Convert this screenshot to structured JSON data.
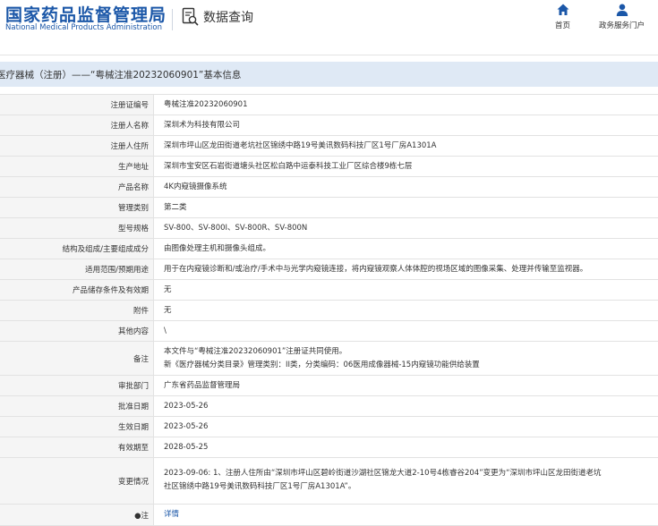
{
  "header": {
    "logo_cn": "国家药品监督管理局",
    "logo_en": "National Medical Products Administration",
    "query_label": "数据查询",
    "nav": [
      {
        "label": "首页",
        "icon": "home-icon"
      },
      {
        "label": "政务服务门户",
        "icon": "user-icon"
      }
    ]
  },
  "title": "医疗器械（注册）——“粤械注准20232060901”基本信息",
  "rows": [
    {
      "label": "注册证编号",
      "value": "粤械注准20232060901"
    },
    {
      "label": "注册人名称",
      "value": "深圳术为科技有限公司"
    },
    {
      "label": "注册人住所",
      "value": "深圳市坪山区龙田街道老坑社区锦绣中路19号美讯数码科技厂区1号厂房A1301A"
    },
    {
      "label": "生产地址",
      "value": "深圳市宝安区石岩街道塘头社区松白路中运泰科技工业厂区综合楼9栋七层"
    },
    {
      "label": "产品名称",
      "value": "4K内窥镜摄像系统"
    },
    {
      "label": "管理类别",
      "value": "第二类"
    },
    {
      "label": "型号规格",
      "value": "SV-800、SV-800I、SV-800R、SV-800N"
    },
    {
      "label": "结构及组成/主要组成成分",
      "value": "由图像处理主机和摄像头组成。"
    },
    {
      "label": "适用范围/预期用途",
      "value": "用于在内窥镜诊断和/或治疗/手术中与光学内窥镜连接，将内窥镜观察人体体腔的视场区域的图像采集、处理并传输至监视器。"
    },
    {
      "label": "产品储存条件及有效期",
      "value": "无"
    },
    {
      "label": "附件",
      "value": "无"
    },
    {
      "label": "其他内容",
      "value": "\\"
    },
    {
      "label": "备注",
      "value_lines": [
        "本文件与“粤械注准20232060901”注册证共同使用。",
        "新《医疗器械分类目录》管理类别：II类，分类编码：06医用成像器械-15内窥镜功能供给装置"
      ]
    },
    {
      "label": "审批部门",
      "value": "广东省药品监督管理局"
    },
    {
      "label": "批准日期",
      "value": "2023-05-26"
    },
    {
      "label": "生效日期",
      "value": "2023-05-26"
    },
    {
      "label": "有效期至",
      "value": "2028-05-25"
    },
    {
      "label": "变更情况",
      "value_lines": [
        "2023-09-06: 1、注册人住所由“深圳市坪山区碧岭街道沙湖社区锦龙大道2-10号4栋睿谷204”变更为“深圳市坪山区龙田街道老坑",
        "社区锦绣中路19号美讯数码科技厂区1号厂房A1301A”。"
      ]
    },
    {
      "label": "●注",
      "value": "详情"
    }
  ]
}
